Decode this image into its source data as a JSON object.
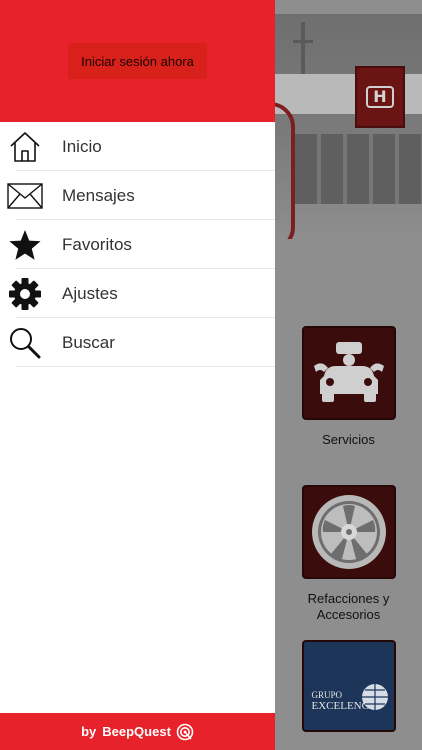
{
  "drawer": {
    "login_label": "Iniciar sesión ahora",
    "menu": [
      {
        "label": "Inicio",
        "icon": "home-icon"
      },
      {
        "label": "Mensajes",
        "icon": "envelope-icon"
      },
      {
        "label": "Favoritos",
        "icon": "star-icon"
      },
      {
        "label": "Ajustes",
        "icon": "gear-icon"
      },
      {
        "label": "Buscar",
        "icon": "search-icon"
      }
    ],
    "footer": {
      "by": "by",
      "brand": "BeepQuest",
      "icon": "beepquest-logo-icon"
    }
  },
  "background": {
    "tiles": [
      {
        "label": "Servicios",
        "icon": "mechanic-car-icon"
      },
      {
        "label_line1": "Refacciones y",
        "label_line2": "Accesorios",
        "icon": "wheel-rim-icon"
      },
      {
        "logo_line1": "GRUPO",
        "logo_line2": "EXCELENCIA",
        "icon": "globe-logo-icon"
      }
    ]
  },
  "colors": {
    "header_red": "#e8222a",
    "login_button": "#d8211b",
    "tile_dark": "#3a0c0c"
  }
}
